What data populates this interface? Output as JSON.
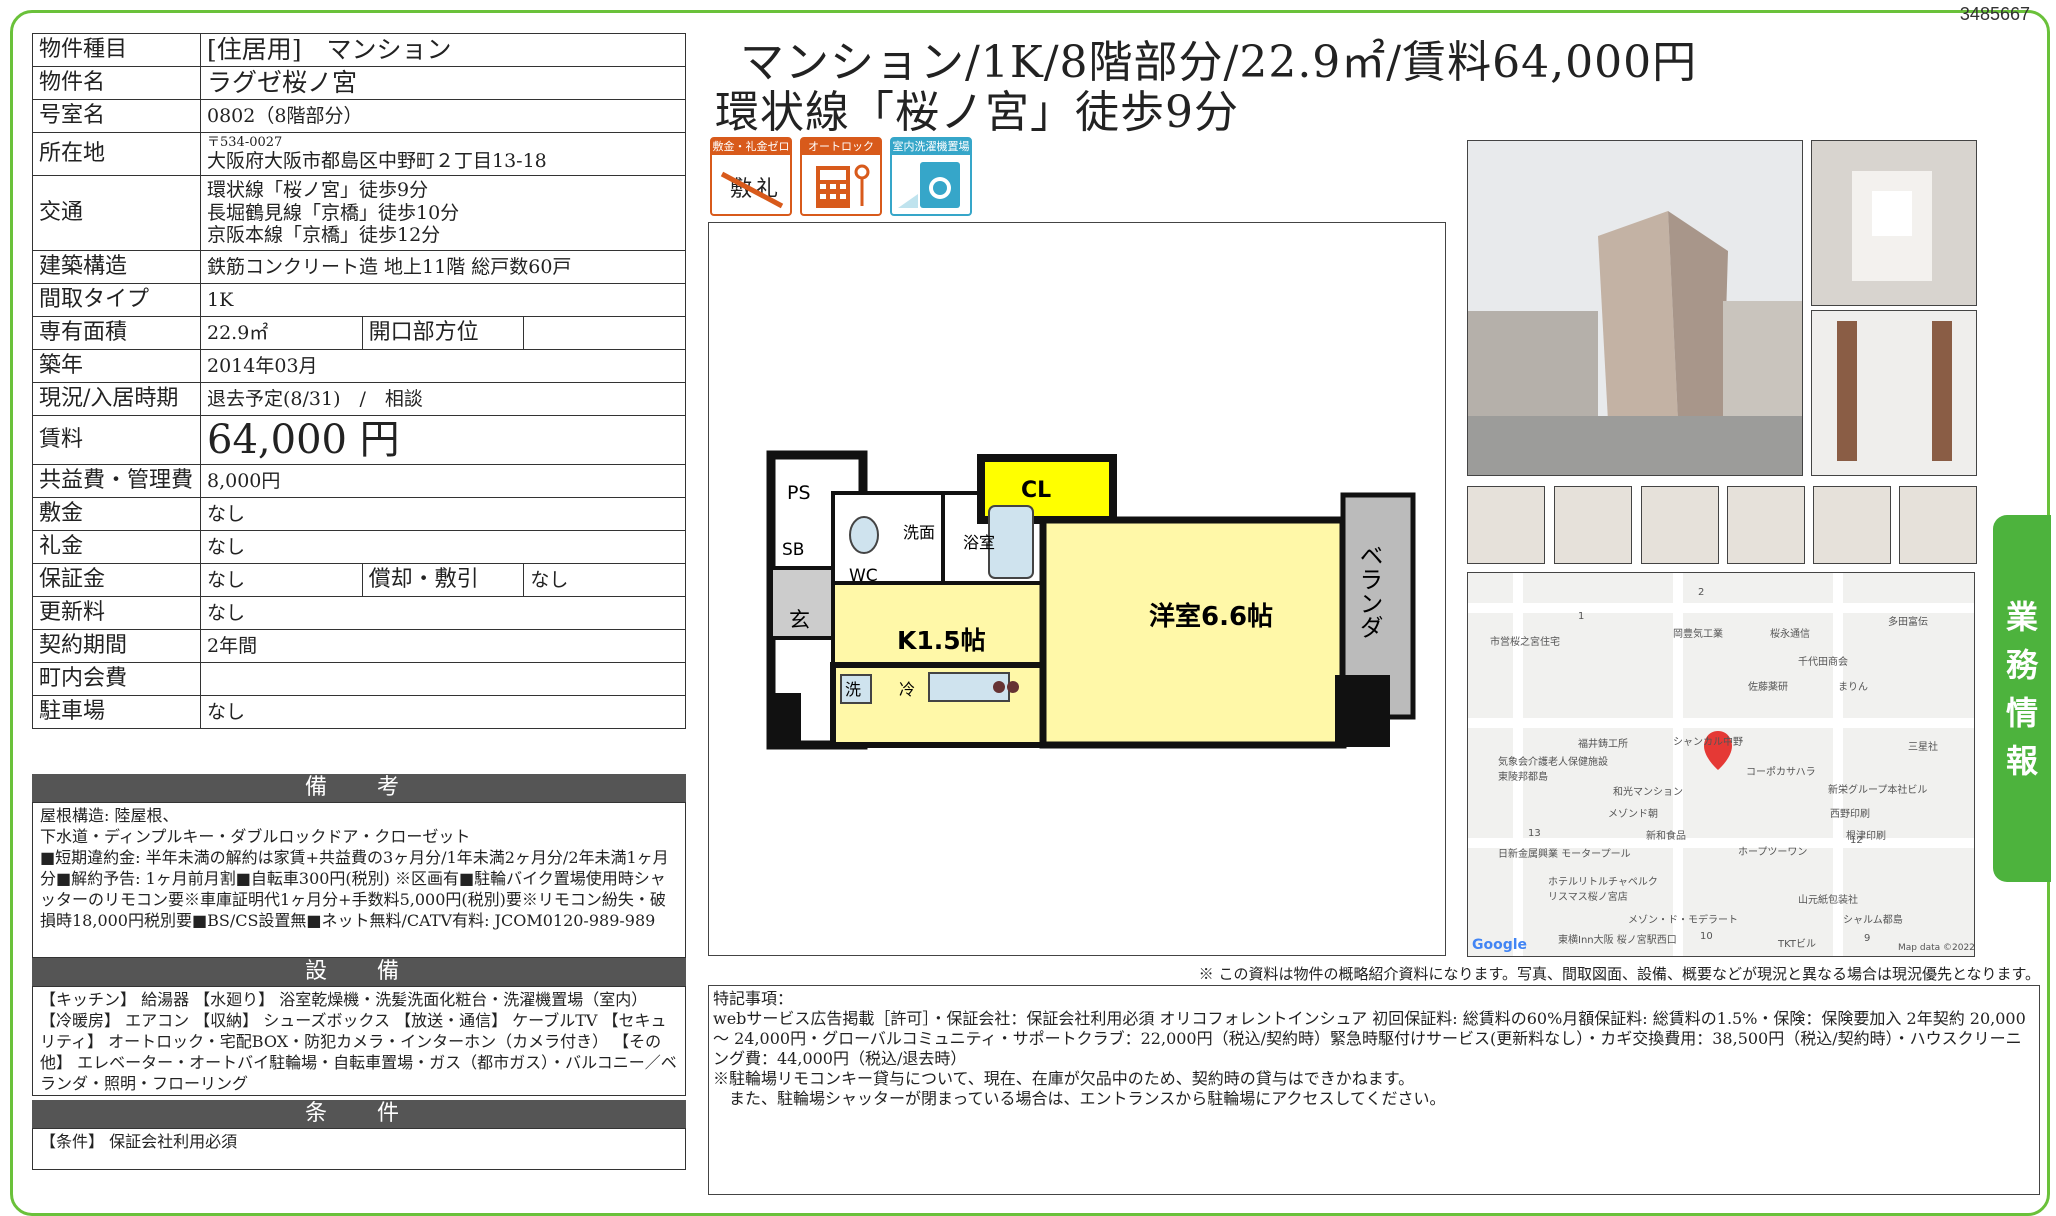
{
  "doc_id": "3485667",
  "rows": [
    {
      "label": "物件種目",
      "value": "[住居用]　マンション"
    },
    {
      "label": "物件名",
      "value": "ラグゼ桜ノ宮"
    },
    {
      "label": "号室名",
      "value": "0802（8階部分）"
    },
    {
      "label": "所在地",
      "postal": "〒534-0027",
      "value": "大阪府大阪市都島区中野町２丁目13-18"
    },
    {
      "label": "交通",
      "lines": [
        "環状線「桜ノ宮」徒歩9分",
        "長堀鶴見線「京橋」徒歩10分",
        "京阪本線「京橋」徒歩12分"
      ]
    },
    {
      "label": "建築構造",
      "value": "鉄筋コンクリート造 地上11階 総戸数60戸"
    },
    {
      "label": "間取タイプ",
      "value": "1K"
    },
    {
      "label": "専有面積",
      "value": "22.9㎡",
      "label2": "開口部方位",
      "value2": ""
    },
    {
      "label": "築年",
      "value": "2014年03月"
    },
    {
      "label": "現況/入居時期",
      "value": "退去予定(8/31)　/　相談"
    },
    {
      "label": "賃料",
      "value": "64,000 円"
    },
    {
      "label": "共益費・管理費",
      "value": "8,000円"
    },
    {
      "label": "敷金",
      "value": "なし"
    },
    {
      "label": "礼金",
      "value": "なし"
    },
    {
      "label": "保証金",
      "value": "なし",
      "label2": "償却・敷引",
      "value2": "なし"
    },
    {
      "label": "更新料",
      "value": "なし"
    },
    {
      "label": "契約期間",
      "value": "2年間"
    },
    {
      "label": "町内会費",
      "value": ""
    },
    {
      "label": "駐車場",
      "value": "なし"
    }
  ],
  "sections": {
    "remarks_title": "備　考",
    "remarks": [
      "屋根構造: 陸屋根、",
      "下水道・ディンプルキー・ダブルロックドア・クローゼット",
      "■短期違約金: 半年未満の解約は家賃+共益費の3ヶ月分/1年未満2ヶ月分/2年未満1ヶ月分■解約予告: 1ヶ月前月割■自転車300円(税別) ※区画有■駐輪バイク置場使用時シャッターのリモコン要※車庫証明代1ヶ月分+手数料5,000円(税別)要※リモコン紛失・破損時18,000円税別要■BS/CS設置無■ネット無料/CATV有料: JCOM0120-989-989"
    ],
    "equip_title": "設　備",
    "equip": "【キッチン】 給湯器 【水廻り】 浴室乾燥機・洗髪洗面化粧台・洗濯機置場（室内） 【冷暖房】 エアコン 【収納】 シューズボックス 【放送・通信】 ケーブルTV 【セキュリティ】 オートロック・宅配BOX・防犯カメラ・インターホン（カメラ付き） 【その他】 エレベーター・オートバイ駐輪場・自転車置場・ガス（都市ガス）・バルコニー／ベランダ・照明・フローリング",
    "cond_title": "条　件",
    "cond": "【条件】 保証会社利用必須"
  },
  "heading": {
    "line1": "マンション/1K/8階部分/22.9㎡/賃料64,000円",
    "line2": "環状線「桜ノ宮」徒歩9分"
  },
  "badges": [
    {
      "caption": "敷金・礼金ゼロ",
      "icon": "no-deposit-icon"
    },
    {
      "caption": "オートロック",
      "icon": "autolock-icon"
    },
    {
      "caption": "室内洗濯機置場",
      "icon": "washing-machine-icon"
    }
  ],
  "floorplan": {
    "ps": "PS",
    "sb": "SB",
    "cl": "CL",
    "wc": "WC",
    "sen": "洗面",
    "bath": "浴室",
    "gen": "玄",
    "kitchen": "K1.5帖",
    "room": "洋室6.6帖",
    "veranda": "ベランダ",
    "wash": "洗",
    "rei": "冷"
  },
  "map_labels": [
    "市営桜之宮住宅",
    "岡豊気工業",
    "桜永通信",
    "千代田商会",
    "多田富伝",
    "佐藤薬研",
    "まりん",
    "三星社",
    "福井鋳工所",
    "シャンカル中野",
    "気象会介護老人保健施設東陵邦都島",
    "コーポカサハラ",
    "新栄グループ本社ビル",
    "和光マンション",
    "西野印刷",
    "メゾンド朝",
    "新和食品",
    "根津印刷",
    "ホープツーワン",
    "日新金属興業 モータープール",
    "ホテルリトルチャペルクリスマス桜ノ宮店",
    "山元紙包装社",
    "メゾン・ド・モデラート",
    "シャルム都島",
    "東横Inn大阪 桜ノ宮駅西口",
    "TKTビル",
    "Google",
    "Map data ©2022",
    "1",
    "2",
    "13",
    "12",
    "10",
    "9"
  ],
  "side_tab": "業務情報",
  "disclaimer": "※ この資料は物件の概略紹介資料になります。写真、間取図面、設備、概要などが現況と異なる場合は現況優先となります。",
  "tokki": [
    "特記事項：",
    "webサービス広告掲載［許可］・保証会社：保証会社利用必須 オリコフォレントインシュア 初回保証料: 総賃料の60%月額保証料: 総賃料の1.5%・保険：保険要加入 2年契約 20,000 〜 24,000円・グローバルコミュニティ・サポートクラブ：22,000円（税込/契約時）緊急時駆付けサービス(更新料なし）・カギ交換費用：38,500円（税込/契約時）・ハウスクリーニング費：44,000円（税込/退去時）",
    "※駐輪場リモコンキー貸与について、現在、在庫が欠品中のため、契約時の貸与はできかねます。",
    "　また、駐輪場シャッターが閉まっている場合は、エントランスから駐輪場にアクセスしてください。"
  ]
}
